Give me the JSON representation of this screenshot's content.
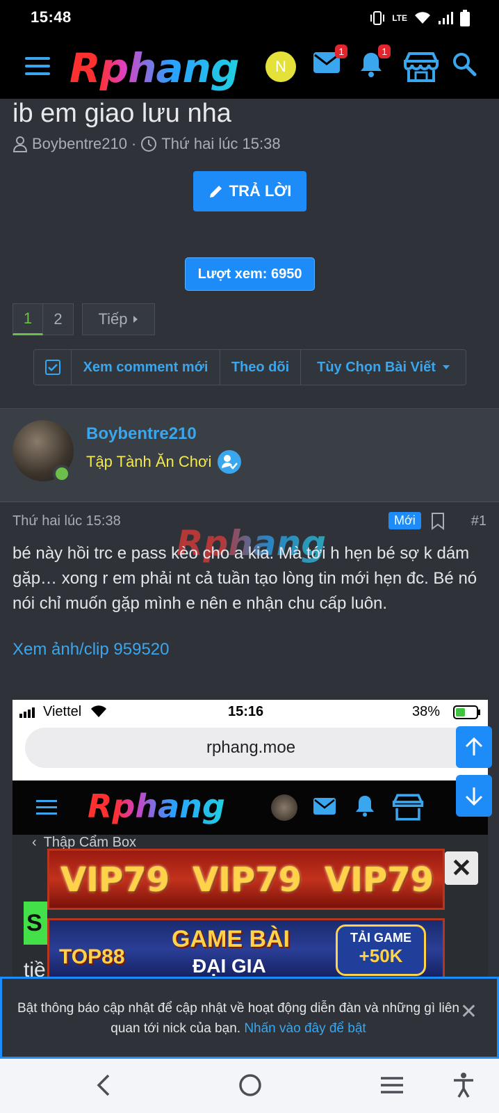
{
  "status_bar": {
    "time": "15:48",
    "network": "LTE"
  },
  "header": {
    "logo": "Rphang",
    "avatar_initial": "N",
    "inbox_badge": "1",
    "alerts_badge": "1",
    "icons": [
      "menu-icon",
      "mail-icon",
      "bell-icon",
      "store-icon",
      "search-icon"
    ],
    "accent_color": "#3aa6ee"
  },
  "thread": {
    "title": "ib em giao lưu nha",
    "author": "Boybentre210",
    "separator": "·",
    "date": "Thứ hai lúc 15:38",
    "reply_button": "TRẢ LỜI",
    "views": "Lượt xem: 6950"
  },
  "pagination": {
    "pages": [
      "1",
      "2"
    ],
    "current": "1",
    "next": "Tiếp"
  },
  "actions": {
    "new_comments": "Xem comment mới",
    "follow": "Theo dõi",
    "options": "Tùy Chọn Bài Viết"
  },
  "post": {
    "username": "Boybentre210",
    "user_title": "Tập Tành Ăn Chơi",
    "date": "Thứ hai lúc 15:38",
    "new_badge": "Mới",
    "number": "#1",
    "body": "bé này hồi trc e pass kèo cho a kia. Mà tới h hẹn bé sợ k dám gặp… xong r em phải nt cả tuần tạo lòng tin mới hẹn đc. Bé nó nói chỉ muốn gặp mình e nên e nhận chu cấp luôn.",
    "watermark": "Rphang",
    "link": "Xem ảnh/clip 959520"
  },
  "embedded_screenshot": {
    "carrier": "Viettel",
    "time": "15:16",
    "battery": "38%",
    "url": "rphang.moe",
    "logo": "Rphang",
    "breadcrumb": "Thập Cẩm Box",
    "ad1_text": "VIP79",
    "ad2_left": "TOP88",
    "ad2_center_line1": "GAME BÀI",
    "ad2_center_line2": "ĐẠI GIA",
    "ad2_right_line1": "TẢI GAME",
    "ad2_right_line2": "+50K",
    "partial_letter": "S",
    "partial_line_text": "tiề"
  },
  "notification": {
    "text": "Bật thông báo cập nhật để cập nhật về hoạt động diễn đàn và những gì liên quan tới nick của bạn.",
    "link": "Nhấn vào đây để bật"
  },
  "system_nav": {
    "icons": [
      "back-icon",
      "home-icon",
      "recents-icon",
      "accessibility-icon"
    ]
  }
}
